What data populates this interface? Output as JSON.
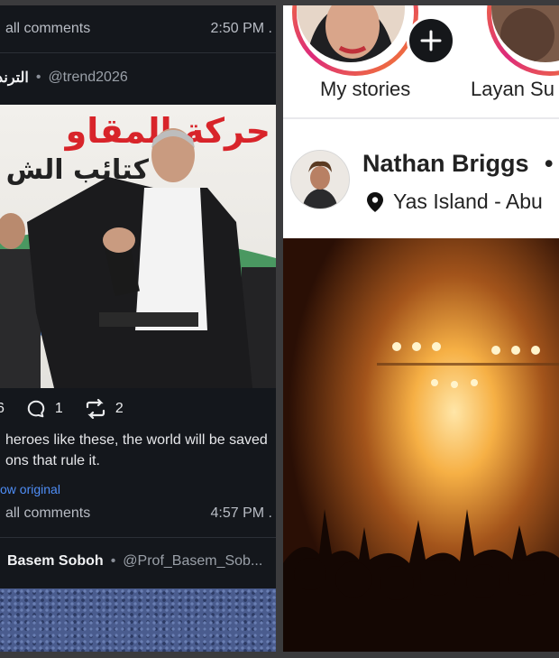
{
  "left_panel": {
    "comments_row_1": {
      "label": "all comments",
      "time": "2:50 PM ."
    },
    "post_author": {
      "name": "الترند",
      "handle": "@trend2026"
    },
    "photo_banner_text": "حركة المقاو",
    "photo_banner_text_2": "كتائب الش",
    "stats": {
      "likes": "6",
      "comments": "1",
      "reposts": "2"
    },
    "post_text_line_1": "heroes like these, the world will be saved",
    "post_text_line_2": "ons that rule it.",
    "show_original": "ow original",
    "comments_row_2": {
      "label": "all comments",
      "time": "4:57 PM ."
    },
    "next_author": {
      "name": "Basem Soboh",
      "handle": "@Prof_Basem_Sob..."
    }
  },
  "right_panel": {
    "stories": [
      {
        "label": "My stories"
      },
      {
        "label": "Layan Su"
      }
    ],
    "post": {
      "name": "Nathan Briggs",
      "name_suffix": "•",
      "location": "Yas Island - Abu"
    }
  },
  "colors": {
    "dark_bg": "#14171c",
    "accent_link": "#4f8ef7",
    "story_ring": "#f58529"
  }
}
